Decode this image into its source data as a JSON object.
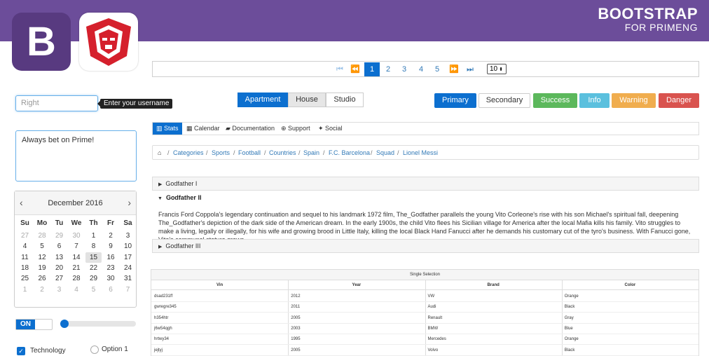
{
  "brand": {
    "title": "BOOTSTRAP",
    "subtitle": "FOR PRIMENG",
    "logo_letter": "B"
  },
  "paginator": {
    "first_icon": "first-page-icon",
    "prev_icon": "prev-page-icon",
    "pages": [
      "1",
      "2",
      "3",
      "4",
      "5"
    ],
    "active_page": "1",
    "next_icon": "next-page-icon",
    "last_icon": "last-page-icon",
    "rows_per_page": "10"
  },
  "input": {
    "placeholder": "Right",
    "tooltip": "Enter your username"
  },
  "textarea": {
    "value": "Always bet on Prime!"
  },
  "calendar": {
    "title": "December 2016",
    "weekdays": [
      "Su",
      "Mo",
      "Tu",
      "We",
      "Th",
      "Fr",
      "Sa"
    ],
    "weeks": [
      [
        "27",
        "28",
        "29",
        "30",
        "1",
        "2",
        "3"
      ],
      [
        "4",
        "5",
        "6",
        "7",
        "8",
        "9",
        "10"
      ],
      [
        "11",
        "12",
        "13",
        "14",
        "15",
        "16",
        "17"
      ],
      [
        "18",
        "19",
        "20",
        "21",
        "22",
        "23",
        "24"
      ],
      [
        "25",
        "26",
        "27",
        "28",
        "29",
        "30",
        "31"
      ],
      [
        "1",
        "2",
        "3",
        "4",
        "5",
        "6",
        "7"
      ]
    ],
    "today": "15"
  },
  "toggle": {
    "label": "ON"
  },
  "slider": {
    "value_percent": 0
  },
  "checkbox": {
    "label": "Technology",
    "checked": true
  },
  "radio": {
    "label": "Option 1",
    "checked": false
  },
  "select_button": {
    "options": [
      "Apartment",
      "House",
      "Studio"
    ],
    "selected": "Apartment"
  },
  "severity_buttons": [
    {
      "label": "Primary",
      "color": "#0c6fcf"
    },
    {
      "label": "Secondary",
      "color": "#ffffff"
    },
    {
      "label": "Success",
      "color": "#5cb85c"
    },
    {
      "label": "Info",
      "color": "#5bc0de"
    },
    {
      "label": "Warning",
      "color": "#f0ad4e"
    },
    {
      "label": "Danger",
      "color": "#d9534f"
    }
  ],
  "tabmenu": [
    {
      "label": "Stats",
      "icon": "bar-chart-icon",
      "active": true
    },
    {
      "label": "Calendar",
      "icon": "calendar-icon"
    },
    {
      "label": "Documentation",
      "icon": "book-icon"
    },
    {
      "label": "Support",
      "icon": "support-icon"
    },
    {
      "label": "Social",
      "icon": "twitter-icon"
    }
  ],
  "breadcrumb": {
    "home_icon": "home-icon",
    "items": [
      "Categories",
      "Sports",
      "Football",
      "Countries",
      "Spain",
      "F.C. Barcelona",
      "Squad",
      "Lionel Messi"
    ]
  },
  "accordion": {
    "tabs": [
      "Godfather I",
      "Godfather II",
      "Godfather III"
    ],
    "open_content": "Francis Ford Coppola's legendary continuation and sequel to his landmark 1972 film, The_Godfather parallels the young Vito Corleone's rise with his son Michael's spiritual fall, deepening The_Godfather's depiction of the dark side of the American dream. In the early 1900s, the child Vito flees his Sicilian village for America after the local Mafia kills his family. Vito struggles to make a living, legally or illegally, for his wife and growing brood in Little Italy, killing the local Black Hand Fanucci after he demands his customary cut of the tyro's business. With Fanucci gone, Vito's communal stature grows."
  },
  "table": {
    "caption": "Single Selection",
    "columns": [
      "Vin",
      "Year",
      "Brand",
      "Color"
    ],
    "rows": [
      [
        "dsad231ff",
        "2012",
        "VW",
        "Orange"
      ],
      [
        "gwregre345",
        "2011",
        "Audi",
        "Black"
      ],
      [
        "h354htr",
        "2005",
        "Renault",
        "Gray"
      ],
      [
        "j6w54qgh",
        "2003",
        "BMW",
        "Blue"
      ],
      [
        "hrtwy34",
        "1995",
        "Mercedes",
        "Orange"
      ],
      [
        "jejtyj",
        "2005",
        "Volvo",
        "Black"
      ]
    ]
  }
}
